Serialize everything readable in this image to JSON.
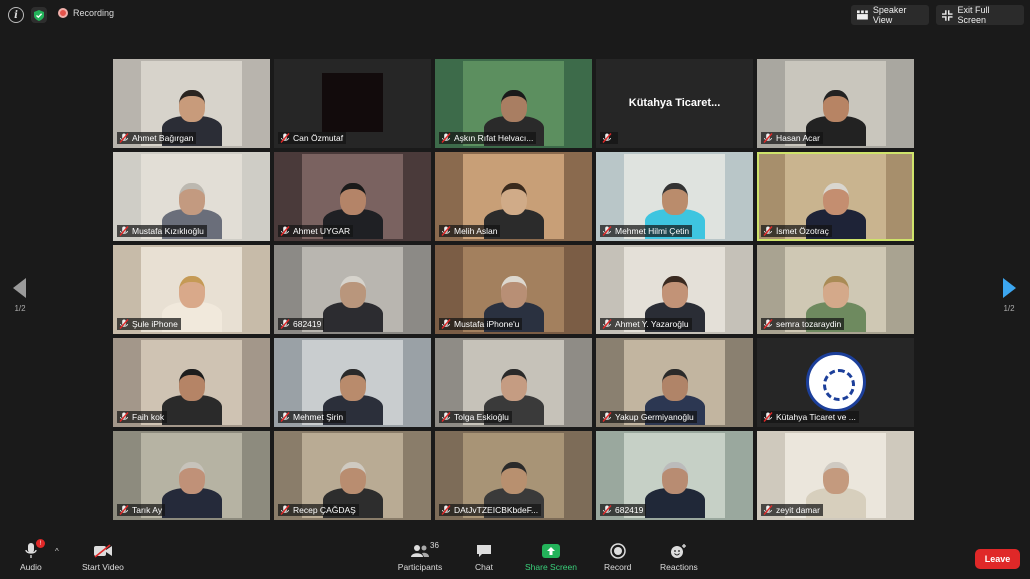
{
  "topbar": {
    "recording_label": "Recording",
    "speaker_view_label": "Speaker View",
    "exit_fullscreen_label": "Exit Full Screen"
  },
  "pagination": {
    "left": "1/2",
    "right": "1/2"
  },
  "participants": [
    {
      "name": "Ahmet Bağırgan",
      "bg": "#b8b4ad",
      "wall": "#d7d3cb",
      "skin": "#c89b7b",
      "shirt": "#2b2d36",
      "hair": "#2a2420"
    },
    {
      "name": "Can Özmutaf",
      "bg": "#262626",
      "blank": "#120b0c"
    },
    {
      "name": "Aşkın Rıfat Helvacı...",
      "bg": "#3d6b4a",
      "wall": "#5c8f5f",
      "skin": "#a97e62",
      "shirt": "#2a2a2a",
      "hair": "#1a1a1a"
    },
    {
      "name": "",
      "label": "Kütahya  Ticaret...",
      "bg": "#262626"
    },
    {
      "name": "Hasan Acar",
      "bg": "#a9a7a0",
      "wall": "#c9c6bd",
      "skin": "#b78464",
      "shirt": "#222",
      "hair": "#222"
    },
    {
      "name": "Mustafa Kızıklıoğlu",
      "bg": "#cfcdc6",
      "wall": "#e2ded6",
      "skin": "#c39a80",
      "shirt": "#6a6e7a",
      "hair": "#bcb8b0"
    },
    {
      "name": "Ahmet UYGAR",
      "bg": "#4a3a3a",
      "wall": "#7a6260",
      "skin": "#b48468",
      "shirt": "#1f2024",
      "hair": "#1a1a1a"
    },
    {
      "name": "Melih Aslan",
      "bg": "#8a6a4e",
      "wall": "#c89f77",
      "skin": "#d0ab88",
      "shirt": "#2b2b2b",
      "hair": "#3a2a1d"
    },
    {
      "name": "Mehmet Hilmi Çetin",
      "bg": "#b9c6c8",
      "wall": "#dfe3df",
      "skin": "#ba8c6c",
      "shirt": "#3ec5e0",
      "hair": "#333"
    },
    {
      "name": "İsmet Özotraç",
      "bg": "#a78f6c",
      "wall": "#c9b48f",
      "skin": "#c48e70",
      "shirt": "#1e2337",
      "hair": "#d9d6cf",
      "speaking": true
    },
    {
      "name": "Şule iPhone",
      "bg": "#c7bba9",
      "wall": "#e8e0d3",
      "skin": "#d9a98a",
      "shirt": "#f1e9dc",
      "hair": "#c59a55"
    },
    {
      "name": "682419",
      "bg": "#8c8a86",
      "wall": "#b9b6b0",
      "skin": "#b9967c",
      "shirt": "#2c2c30",
      "hair": "#d6d3cc"
    },
    {
      "name": "Mustafa iPhone'u",
      "bg": "#7b5d45",
      "wall": "#a3805e",
      "skin": "#b88f75",
      "shirt": "#2a3140",
      "hair": "#ddd8cf"
    },
    {
      "name": "Ahmet Y. Yazaroğlu",
      "bg": "#c5c1b8",
      "wall": "#e4e0d8",
      "skin": "#c29377",
      "shirt": "#2a2d35",
      "hair": "#3a2a20"
    },
    {
      "name": "semra tozaraydin",
      "bg": "#a9a391",
      "wall": "#cfc8b4",
      "skin": "#d4a98a",
      "shirt": "#6e8a5f",
      "hair": "#a98b55"
    },
    {
      "name": "Faih kok",
      "bg": "#a3978a",
      "wall": "#cfc3b3",
      "skin": "#b58466",
      "shirt": "#2a2a2a",
      "hair": "#1d1d1d"
    },
    {
      "name": "Mehmet Şirin",
      "bg": "#9aa1a6",
      "wall": "#c9cdcf",
      "skin": "#b98b6c",
      "shirt": "#2b2f3a",
      "hair": "#2a2a2a"
    },
    {
      "name": "Tolga Eskioğlu",
      "bg": "#8f8c86",
      "wall": "#c6c2b9",
      "skin": "#c59c82",
      "shirt": "#3a3a3a",
      "hair": "#2a2a2a"
    },
    {
      "name": "Yakup Germiyanoğlu",
      "bg": "#8a8070",
      "wall": "#c2b5a0",
      "skin": "#b08468",
      "shirt": "#2c3752",
      "hair": "#2a2a2a"
    },
    {
      "name": "Kütahya Ticaret ve ...",
      "bg": "#262626",
      "logo": true
    },
    {
      "name": "Tarık Ay",
      "bg": "#8d8b7e",
      "wall": "#b6b3a3",
      "skin": "#c09178",
      "shirt": "#252a3a",
      "hair": "#c7c3bb"
    },
    {
      "name": "Recep ÇAĞDAŞ",
      "bg": "#8a7d6a",
      "wall": "#b9ab94",
      "skin": "#b98d70",
      "shirt": "#2d2d2d",
      "hair": "#cfcac1"
    },
    {
      "name": "DAtJvTZEICBKbdeF...",
      "bg": "#7d6c58",
      "wall": "#a89476",
      "skin": "#b8906f",
      "shirt": "#3a3a3a",
      "hair": "#2a2a2a"
    },
    {
      "name": "682419",
      "bg": "#9aa89e",
      "wall": "#c6d0c6",
      "skin": "#b88c72",
      "shirt": "#202838",
      "hair": "#bbb"
    },
    {
      "name": "zeyit damar",
      "bg": "#cfc9bd",
      "wall": "#ebe6dc",
      "skin": "#c49a7e",
      "shirt": "#d7cfbd",
      "hair": "#cfcac2"
    }
  ],
  "toolbar": {
    "audio_label": "Audio",
    "video_label": "Start Video",
    "participants_label": "Participants",
    "participants_count": "36",
    "chat_label": "Chat",
    "share_label": "Share Screen",
    "record_label": "Record",
    "reactions_label": "Reactions",
    "leave_label": "Leave",
    "audio_badge": "!"
  }
}
